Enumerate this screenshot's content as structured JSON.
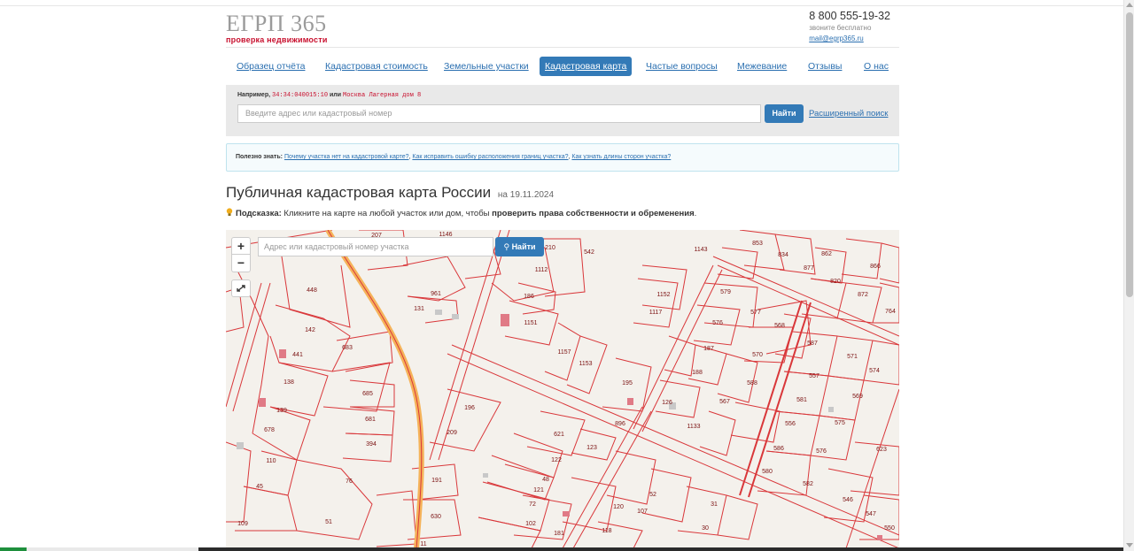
{
  "header": {
    "logo": "ЕГРП 365",
    "logo_sub": "проверка недвижимости",
    "phone": "8 800 555-19-32",
    "phone_note": "звоните бесплатно",
    "email": "mail@egrp365.ru"
  },
  "nav": {
    "items": [
      {
        "label": "Образец отчёта"
      },
      {
        "label": "Кадастровая стоимость"
      },
      {
        "label": "Земельные участки"
      },
      {
        "label": "Кадастровая карта"
      },
      {
        "label": "Частые вопросы"
      },
      {
        "label": "Межевание"
      },
      {
        "label": "Отзывы"
      },
      {
        "label": "О нас"
      }
    ],
    "active": "Кадастровая карта"
  },
  "search": {
    "example_prefix": "Например,",
    "example_code": "34:34:040015:10",
    "example_or": "или",
    "example_address": "Москва Лагерная дом 8",
    "placeholder": "Введите адрес или кадастровый номер",
    "button": "Найти",
    "advanced": "Расширенный поиск"
  },
  "useful": {
    "label": "Полезно знать:",
    "links": [
      "Почему участка нет на кадастровой карте?",
      "Как исправить ошибку расположения границ участка?",
      "Как узнать длины сторон участка?"
    ],
    "sep": ","
  },
  "page": {
    "title": "Публичная кадастровая карта России",
    "date": "на 19.11.2024",
    "hint_label": "Подсказка:",
    "hint_text": "Кликните на карте на любой участок или дом, чтобы",
    "hint_bold": "проверить права собственности и обременения",
    "hint_end": "."
  },
  "map": {
    "zoom_in": "+",
    "zoom_out": "−",
    "search_placeholder": "Адрес или кадастровый номер участка",
    "find_button": "Найти",
    "parcels": [
      {
        "n": "207"
      },
      {
        "n": "1146"
      },
      {
        "n": "210"
      },
      {
        "n": "542"
      },
      {
        "n": "1143"
      },
      {
        "n": "853"
      },
      {
        "n": "834"
      },
      {
        "n": "862"
      },
      {
        "n": "866"
      },
      {
        "n": "877"
      },
      {
        "n": "820"
      },
      {
        "n": "872"
      },
      {
        "n": "764"
      },
      {
        "n": "448"
      },
      {
        "n": "961"
      },
      {
        "n": "131"
      },
      {
        "n": "186"
      },
      {
        "n": "1112"
      },
      {
        "n": "1152"
      },
      {
        "n": "1117"
      },
      {
        "n": "579"
      },
      {
        "n": "577"
      },
      {
        "n": "568"
      },
      {
        "n": "576"
      },
      {
        "n": "142"
      },
      {
        "n": "683"
      },
      {
        "n": "441"
      },
      {
        "n": "1151"
      },
      {
        "n": "1157"
      },
      {
        "n": "1153"
      },
      {
        "n": "187"
      },
      {
        "n": "570"
      },
      {
        "n": "587"
      },
      {
        "n": "571"
      },
      {
        "n": "574"
      },
      {
        "n": "138"
      },
      {
        "n": "685"
      },
      {
        "n": "681"
      },
      {
        "n": "394"
      },
      {
        "n": "139"
      },
      {
        "n": "678"
      },
      {
        "n": "196"
      },
      {
        "n": "209"
      },
      {
        "n": "195"
      },
      {
        "n": "188"
      },
      {
        "n": "588"
      },
      {
        "n": "557"
      },
      {
        "n": "569"
      },
      {
        "n": "567"
      },
      {
        "n": "126"
      },
      {
        "n": "1133"
      },
      {
        "n": "581"
      },
      {
        "n": "575"
      },
      {
        "n": "556"
      },
      {
        "n": "621"
      },
      {
        "n": "123"
      },
      {
        "n": "896"
      },
      {
        "n": "110"
      },
      {
        "n": "45"
      },
      {
        "n": "76"
      },
      {
        "n": "191"
      },
      {
        "n": "122"
      },
      {
        "n": "48"
      },
      {
        "n": "121"
      },
      {
        "n": "72"
      },
      {
        "n": "586"
      },
      {
        "n": "576"
      },
      {
        "n": "623"
      },
      {
        "n": "580"
      },
      {
        "n": "582"
      },
      {
        "n": "52"
      },
      {
        "n": "107"
      },
      {
        "n": "31"
      },
      {
        "n": "546"
      },
      {
        "n": "547"
      },
      {
        "n": "630"
      },
      {
        "n": "51"
      },
      {
        "n": "109"
      },
      {
        "n": "102"
      },
      {
        "n": "30"
      },
      {
        "n": "550"
      },
      {
        "n": "11"
      },
      {
        "n": "120"
      },
      {
        "n": "118"
      },
      {
        "n": "181"
      }
    ]
  }
}
